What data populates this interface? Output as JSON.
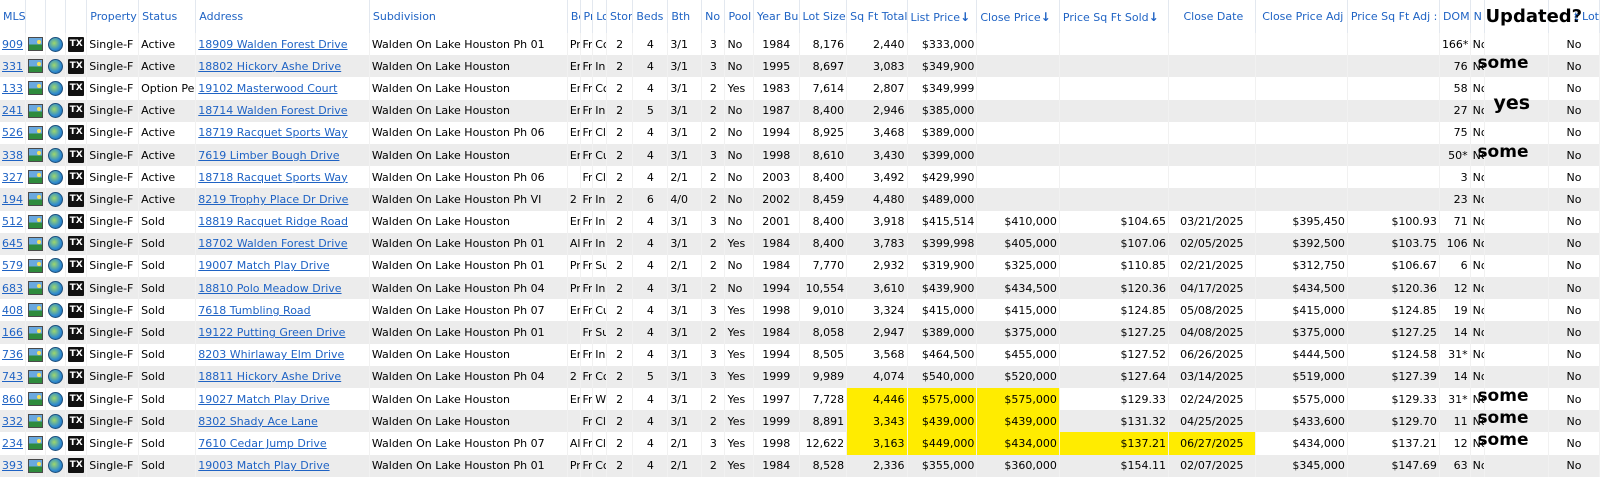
{
  "headers": [
    "MLS",
    "",
    "",
    "",
    "Property",
    "Status",
    "Address",
    "Subdivision",
    "Be",
    "Pr",
    "Lo",
    "Stori",
    "Beds",
    "Bth",
    "No (",
    "Pool",
    "Year Bu",
    "Lot Size",
    "Sq Ft Total",
    "List Price",
    "Close Price",
    "Price Sq Ft Sold",
    "Close Date",
    "Close Price Adj",
    "Price Sq Ft Adj :",
    "DOM",
    "N",
    "Updated?",
    "t Lot"
  ],
  "sort_arrows": {
    "list_price": "↓",
    "close_price": "↓",
    "price_sqft_sold": "↓"
  },
  "icons": {
    "photo": "photo-icon",
    "globe": "map-globe-icon",
    "tax": "tx-icon",
    "tax_label": "TX"
  },
  "colors": {
    "link": "#1f63c4",
    "highlight": "#ffec00",
    "alt_row": "#ececec"
  },
  "rows": [
    {
      "mls": "909",
      "type": "Single-F",
      "status": "Active",
      "address": "18909 Walden Forest Drive",
      "subdivision": "Walden On Lake Houston Ph 01",
      "be": "Pr",
      "pr": "Fr",
      "lo": "Cc",
      "stories": "2",
      "beds": "4",
      "bth": "3/1",
      "no": "3",
      "pool": "No",
      "year": "1984",
      "lot": "8,176",
      "sqft": "2,440",
      "list": "$333,000",
      "close": "",
      "psf": "",
      "cdate": "",
      "cadj": "",
      "psfadj": "",
      "dom": "166*",
      "n": "No",
      "upd": "",
      "tlot": "No"
    },
    {
      "mls": "331",
      "type": "Single-F",
      "status": "Active",
      "address": "18802 Hickory Ashe Drive",
      "subdivision": "Walden On Lake Houston",
      "be": "Er",
      "pr": "Fr",
      "lo": "In",
      "stories": "2",
      "beds": "4",
      "bth": "3/1",
      "no": "3",
      "pool": "No",
      "year": "1995",
      "lot": "8,697",
      "sqft": "3,083",
      "list": "$349,900",
      "close": "",
      "psf": "",
      "cdate": "",
      "cadj": "",
      "psfadj": "",
      "dom": "76",
      "n": "No",
      "upd": "some",
      "tlot": "No"
    },
    {
      "mls": "133",
      "type": "Single-F",
      "status": "Option Pe",
      "address": "19102 Masterwood Court",
      "subdivision": "Walden On Lake Houston",
      "be": "Er",
      "pr": "Fr",
      "lo": "Cc",
      "stories": "2",
      "beds": "4",
      "bth": "3/1",
      "no": "2",
      "pool": "Yes",
      "year": "1983",
      "lot": "7,614",
      "sqft": "2,807",
      "list": "$349,999",
      "close": "",
      "psf": "",
      "cdate": "",
      "cadj": "",
      "psfadj": "",
      "dom": "58",
      "n": "No",
      "upd": "",
      "tlot": "No"
    },
    {
      "mls": "241",
      "type": "Single-F",
      "status": "Active",
      "address": "18714 Walden Forest Drive",
      "subdivision": "Walden On Lake Houston",
      "be": "Er",
      "pr": "Fr",
      "lo": "In",
      "stories": "2",
      "beds": "5",
      "bth": "3/1",
      "no": "2",
      "pool": "No",
      "year": "1987",
      "lot": "8,400",
      "sqft": "2,946",
      "list": "$385,000",
      "close": "",
      "psf": "",
      "cdate": "",
      "cadj": "",
      "psfadj": "",
      "dom": "27",
      "n": "No",
      "upd": "yes",
      "tlot": "No"
    },
    {
      "mls": "526",
      "type": "Single-F",
      "status": "Active",
      "address": "18719 Racquet Sports Way",
      "subdivision": "Walden On Lake Houston Ph 06",
      "be": "Er",
      "pr": "Fr",
      "lo": "Cl",
      "stories": "2",
      "beds": "4",
      "bth": "3/1",
      "no": "2",
      "pool": "No",
      "year": "1994",
      "lot": "8,925",
      "sqft": "3,468",
      "list": "$389,000",
      "close": "",
      "psf": "",
      "cdate": "",
      "cadj": "",
      "psfadj": "",
      "dom": "75",
      "n": "No",
      "upd": "",
      "tlot": "No"
    },
    {
      "mls": "338",
      "type": "Single-F",
      "status": "Active",
      "address": "7619 Limber Bough Drive",
      "subdivision": "Walden On Lake Houston",
      "be": "Er",
      "pr": "Fr",
      "lo": "Cu",
      "stories": "2",
      "beds": "4",
      "bth": "3/1",
      "no": "3",
      "pool": "No",
      "year": "1998",
      "lot": "8,610",
      "sqft": "3,430",
      "list": "$399,000",
      "close": "",
      "psf": "",
      "cdate": "",
      "cadj": "",
      "psfadj": "",
      "dom": "50*",
      "n": "No",
      "upd": "some",
      "tlot": "No"
    },
    {
      "mls": "327",
      "type": "Single-F",
      "status": "Active",
      "address": "18718 Racquet Sports Way",
      "subdivision": "Walden On Lake Houston Ph 06",
      "be": "",
      "pr": "Fr",
      "lo": "Cl",
      "stories": "2",
      "beds": "4",
      "bth": "2/1",
      "no": "2",
      "pool": "No",
      "year": "2003",
      "lot": "8,400",
      "sqft": "3,492",
      "list": "$429,990",
      "close": "",
      "psf": "",
      "cdate": "",
      "cadj": "",
      "psfadj": "",
      "dom": "3",
      "n": "No",
      "upd": "",
      "tlot": "No"
    },
    {
      "mls": "194",
      "type": "Single-F",
      "status": "Active",
      "address": "8219 Trophy Place Dr Drive",
      "subdivision": "Walden On Lake Houston Ph VI",
      "be": "2",
      "pr": "Fr",
      "lo": "In",
      "stories": "2",
      "beds": "6",
      "bth": "4/0",
      "no": "2",
      "pool": "No",
      "year": "2002",
      "lot": "8,459",
      "sqft": "4,480",
      "list": "$489,000",
      "close": "",
      "psf": "",
      "cdate": "",
      "cadj": "",
      "psfadj": "",
      "dom": "23",
      "n": "No",
      "upd": "",
      "tlot": "No"
    },
    {
      "mls": "512",
      "type": "Single-F",
      "status": "Sold",
      "address": "18819 Racquet Ridge Road",
      "subdivision": "Walden On Lake Houston",
      "be": "Er",
      "pr": "Fr",
      "lo": "In",
      "stories": "2",
      "beds": "4",
      "bth": "3/1",
      "no": "3",
      "pool": "No",
      "year": "2001",
      "lot": "8,400",
      "sqft": "3,918",
      "list": "$415,514",
      "close": "$410,000",
      "psf": "$104.65",
      "cdate": "03/21/2025",
      "cadj": "$395,450",
      "psfadj": "$100.93",
      "dom": "71",
      "n": "No",
      "upd": "",
      "tlot": "No"
    },
    {
      "mls": "645",
      "type": "Single-F",
      "status": "Sold",
      "address": "18702 Walden Forest Drive",
      "subdivision": "Walden On Lake Houston Ph 01",
      "be": "Al",
      "pr": "Fr",
      "lo": "In",
      "stories": "2",
      "beds": "4",
      "bth": "3/1",
      "no": "2",
      "pool": "Yes",
      "year": "1984",
      "lot": "8,400",
      "sqft": "3,783",
      "list": "$399,998",
      "close": "$405,000",
      "psf": "$107.06",
      "cdate": "02/05/2025",
      "cadj": "$392,500",
      "psfadj": "$103.75",
      "dom": "106",
      "n": "No",
      "upd": "",
      "tlot": "No"
    },
    {
      "mls": "579",
      "type": "Single-F",
      "status": "Sold",
      "address": "19007 Match Play Drive",
      "subdivision": "Walden On Lake Houston Ph 01",
      "be": "Pr",
      "pr": "Fr",
      "lo": "Su",
      "stories": "2",
      "beds": "4",
      "bth": "2/1",
      "no": "2",
      "pool": "No",
      "year": "1984",
      "lot": "7,770",
      "sqft": "2,932",
      "list": "$319,900",
      "close": "$325,000",
      "psf": "$110.85",
      "cdate": "02/21/2025",
      "cadj": "$312,750",
      "psfadj": "$106.67",
      "dom": "6",
      "n": "No",
      "upd": "",
      "tlot": "No"
    },
    {
      "mls": "683",
      "type": "Single-F",
      "status": "Sold",
      "address": "18810 Polo Meadow Drive",
      "subdivision": "Walden On Lake Houston Ph 04",
      "be": "Pr",
      "pr": "Fr",
      "lo": "In",
      "stories": "2",
      "beds": "4",
      "bth": "3/1",
      "no": "2",
      "pool": "No",
      "year": "1994",
      "lot": "10,554",
      "sqft": "3,610",
      "list": "$439,900",
      "close": "$434,500",
      "psf": "$120.36",
      "cdate": "04/17/2025",
      "cadj": "$434,500",
      "psfadj": "$120.36",
      "dom": "12",
      "n": "No",
      "upd": "",
      "tlot": "No"
    },
    {
      "mls": "408",
      "type": "Single-F",
      "status": "Sold",
      "address": "7618 Tumbling Road",
      "subdivision": "Walden On Lake Houston Ph 07",
      "be": "Er",
      "pr": "Fr",
      "lo": "Cu",
      "stories": "2",
      "beds": "4",
      "bth": "3/1",
      "no": "3",
      "pool": "Yes",
      "year": "1998",
      "lot": "9,010",
      "sqft": "3,324",
      "list": "$415,000",
      "close": "$415,000",
      "psf": "$124.85",
      "cdate": "05/08/2025",
      "cadj": "$415,000",
      "psfadj": "$124.85",
      "dom": "19",
      "n": "No",
      "upd": "",
      "tlot": "No"
    },
    {
      "mls": "166",
      "type": "Single-F",
      "status": "Sold",
      "address": "19122 Putting Green Drive",
      "subdivision": "Walden On Lake Houston Ph 01",
      "be": "",
      "pr": "Fr",
      "lo": "Su",
      "stories": "2",
      "beds": "4",
      "bth": "3/1",
      "no": "2",
      "pool": "Yes",
      "year": "1984",
      "lot": "8,058",
      "sqft": "2,947",
      "list": "$389,000",
      "close": "$375,000",
      "psf": "$127.25",
      "cdate": "04/08/2025",
      "cadj": "$375,000",
      "psfadj": "$127.25",
      "dom": "14",
      "n": "No",
      "upd": "",
      "tlot": "No"
    },
    {
      "mls": "736",
      "type": "Single-F",
      "status": "Sold",
      "address": "8203 Whirlaway Elm Drive",
      "subdivision": "Walden On Lake Houston",
      "be": "Er",
      "pr": "Fr",
      "lo": "In",
      "stories": "2",
      "beds": "4",
      "bth": "3/1",
      "no": "3",
      "pool": "Yes",
      "year": "1994",
      "lot": "8,505",
      "sqft": "3,568",
      "list": "$464,500",
      "close": "$455,000",
      "psf": "$127.52",
      "cdate": "06/26/2025",
      "cadj": "$444,500",
      "psfadj": "$124.58",
      "dom": "31*",
      "n": "No",
      "upd": "",
      "tlot": "No"
    },
    {
      "mls": "743",
      "type": "Single-F",
      "status": "Sold",
      "address": "18811 Hickory Ashe Drive",
      "subdivision": "Walden On Lake Houston Ph 04",
      "be": "2",
      "pr": "Fr",
      "lo": "Cc",
      "stories": "2",
      "beds": "5",
      "bth": "3/1",
      "no": "3",
      "pool": "Yes",
      "year": "1999",
      "lot": "9,989",
      "sqft": "4,074",
      "list": "$540,000",
      "close": "$520,000",
      "psf": "$127.64",
      "cdate": "03/14/2025",
      "cadj": "$519,000",
      "psfadj": "$127.39",
      "dom": "14",
      "n": "No",
      "upd": "",
      "tlot": "No"
    },
    {
      "mls": "860",
      "type": "Single-F",
      "status": "Sold",
      "address": "19027 Match Play Drive",
      "subdivision": "Walden On Lake Houston",
      "be": "Er",
      "pr": "Fr",
      "lo": "W",
      "stories": "2",
      "beds": "4",
      "bth": "3/1",
      "no": "2",
      "pool": "Yes",
      "year": "1997",
      "lot": "7,728",
      "sqft": "4,446",
      "list": "$575,000",
      "close": "$575,000",
      "psf": "$129.33",
      "cdate": "02/24/2025",
      "cadj": "$575,000",
      "psfadj": "$129.33",
      "dom": "31*",
      "n": "No",
      "upd": "some",
      "tlot": "No",
      "hl": [
        "sqft",
        "list",
        "close"
      ]
    },
    {
      "mls": "332",
      "type": "Single-F",
      "status": "Sold",
      "address": "8302 Shady Ace Lane",
      "subdivision": "Walden On Lake Houston",
      "be": "",
      "pr": "Fr",
      "lo": "Cl",
      "stories": "2",
      "beds": "4",
      "bth": "3/1",
      "no": "2",
      "pool": "Yes",
      "year": "1999",
      "lot": "8,891",
      "sqft": "3,343",
      "list": "$439,000",
      "close": "$439,000",
      "psf": "$131.32",
      "cdate": "04/25/2025",
      "cadj": "$433,600",
      "psfadj": "$129.70",
      "dom": "11",
      "n": "No",
      "upd": "some",
      "tlot": "No",
      "hl": [
        "sqft",
        "list",
        "close"
      ]
    },
    {
      "mls": "234",
      "type": "Single-F",
      "status": "Sold",
      "address": "7610 Cedar Jump Drive",
      "subdivision": "Walden On Lake Houston Ph 07",
      "be": "Al",
      "pr": "Fr",
      "lo": "Cl",
      "stories": "2",
      "beds": "4",
      "bth": "2/1",
      "no": "3",
      "pool": "Yes",
      "year": "1998",
      "lot": "12,622",
      "sqft": "3,163",
      "list": "$449,000",
      "close": "$434,000",
      "psf": "$137.21",
      "cdate": "06/27/2025",
      "cadj": "$434,000",
      "psfadj": "$137.21",
      "dom": "12",
      "n": "No",
      "upd": "some",
      "tlot": "No",
      "hl": [
        "sqft",
        "list",
        "close",
        "psf",
        "cdate"
      ]
    },
    {
      "mls": "393",
      "type": "Single-F",
      "status": "Sold",
      "address": "19003 Match Play Drive",
      "subdivision": "Walden On Lake Houston Ph 01",
      "be": "Pr",
      "pr": "Fr",
      "lo": "Cc",
      "stories": "2",
      "beds": "4",
      "bth": "2/1",
      "no": "2",
      "pool": "Yes",
      "year": "1984",
      "lot": "8,528",
      "sqft": "2,336",
      "list": "$355,000",
      "close": "$360,000",
      "psf": "$154.11",
      "cdate": "02/07/2025",
      "cadj": "$345,000",
      "psfadj": "$147.69",
      "dom": "63",
      "n": "No",
      "upd": "",
      "tlot": "No"
    }
  ]
}
